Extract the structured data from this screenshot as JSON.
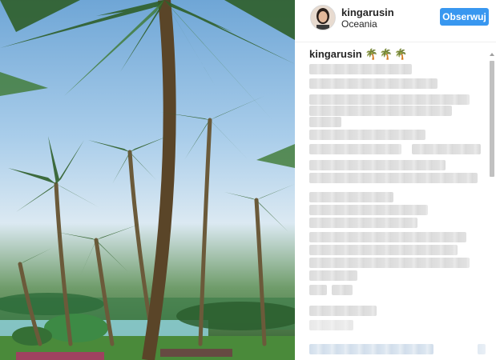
{
  "post": {
    "image_alt": "palm trees on tropical beach"
  },
  "header": {
    "username": "kingarusin",
    "location": "Oceania",
    "follow_label": "Obserwuj"
  },
  "caption": {
    "username": "kingarusin",
    "emoji": "🌴🌴🌴"
  },
  "colors": {
    "accent": "#3897f0",
    "text": "#262626",
    "border": "#efefef"
  }
}
